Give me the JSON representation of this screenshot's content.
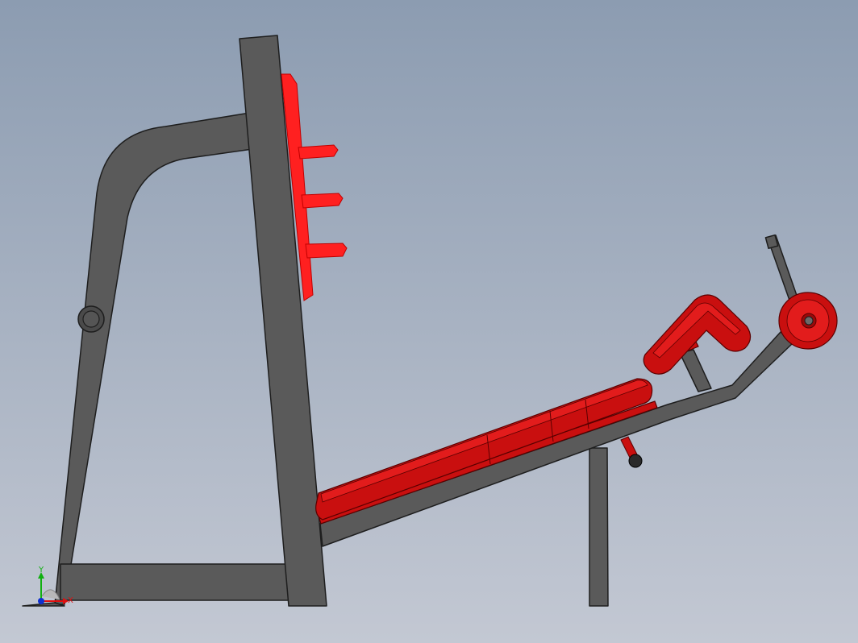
{
  "viewport": {
    "background_top": "#8c9cb1",
    "background_bottom": "#c3c8d3"
  },
  "colors": {
    "frame": "#5a5a5a",
    "frame_edge": "#1e1e1e",
    "pad": "#c90f0f",
    "pad_highlight": "#e21c1c",
    "pad_edge": "#5a0000",
    "plate_holder": "#ff2020",
    "knob": "#2a2a2a"
  },
  "triad": {
    "x_label": "X",
    "y_label": "Y",
    "x_color": "#e01010",
    "y_color": "#10b010",
    "z_color": "#1030d0"
  }
}
